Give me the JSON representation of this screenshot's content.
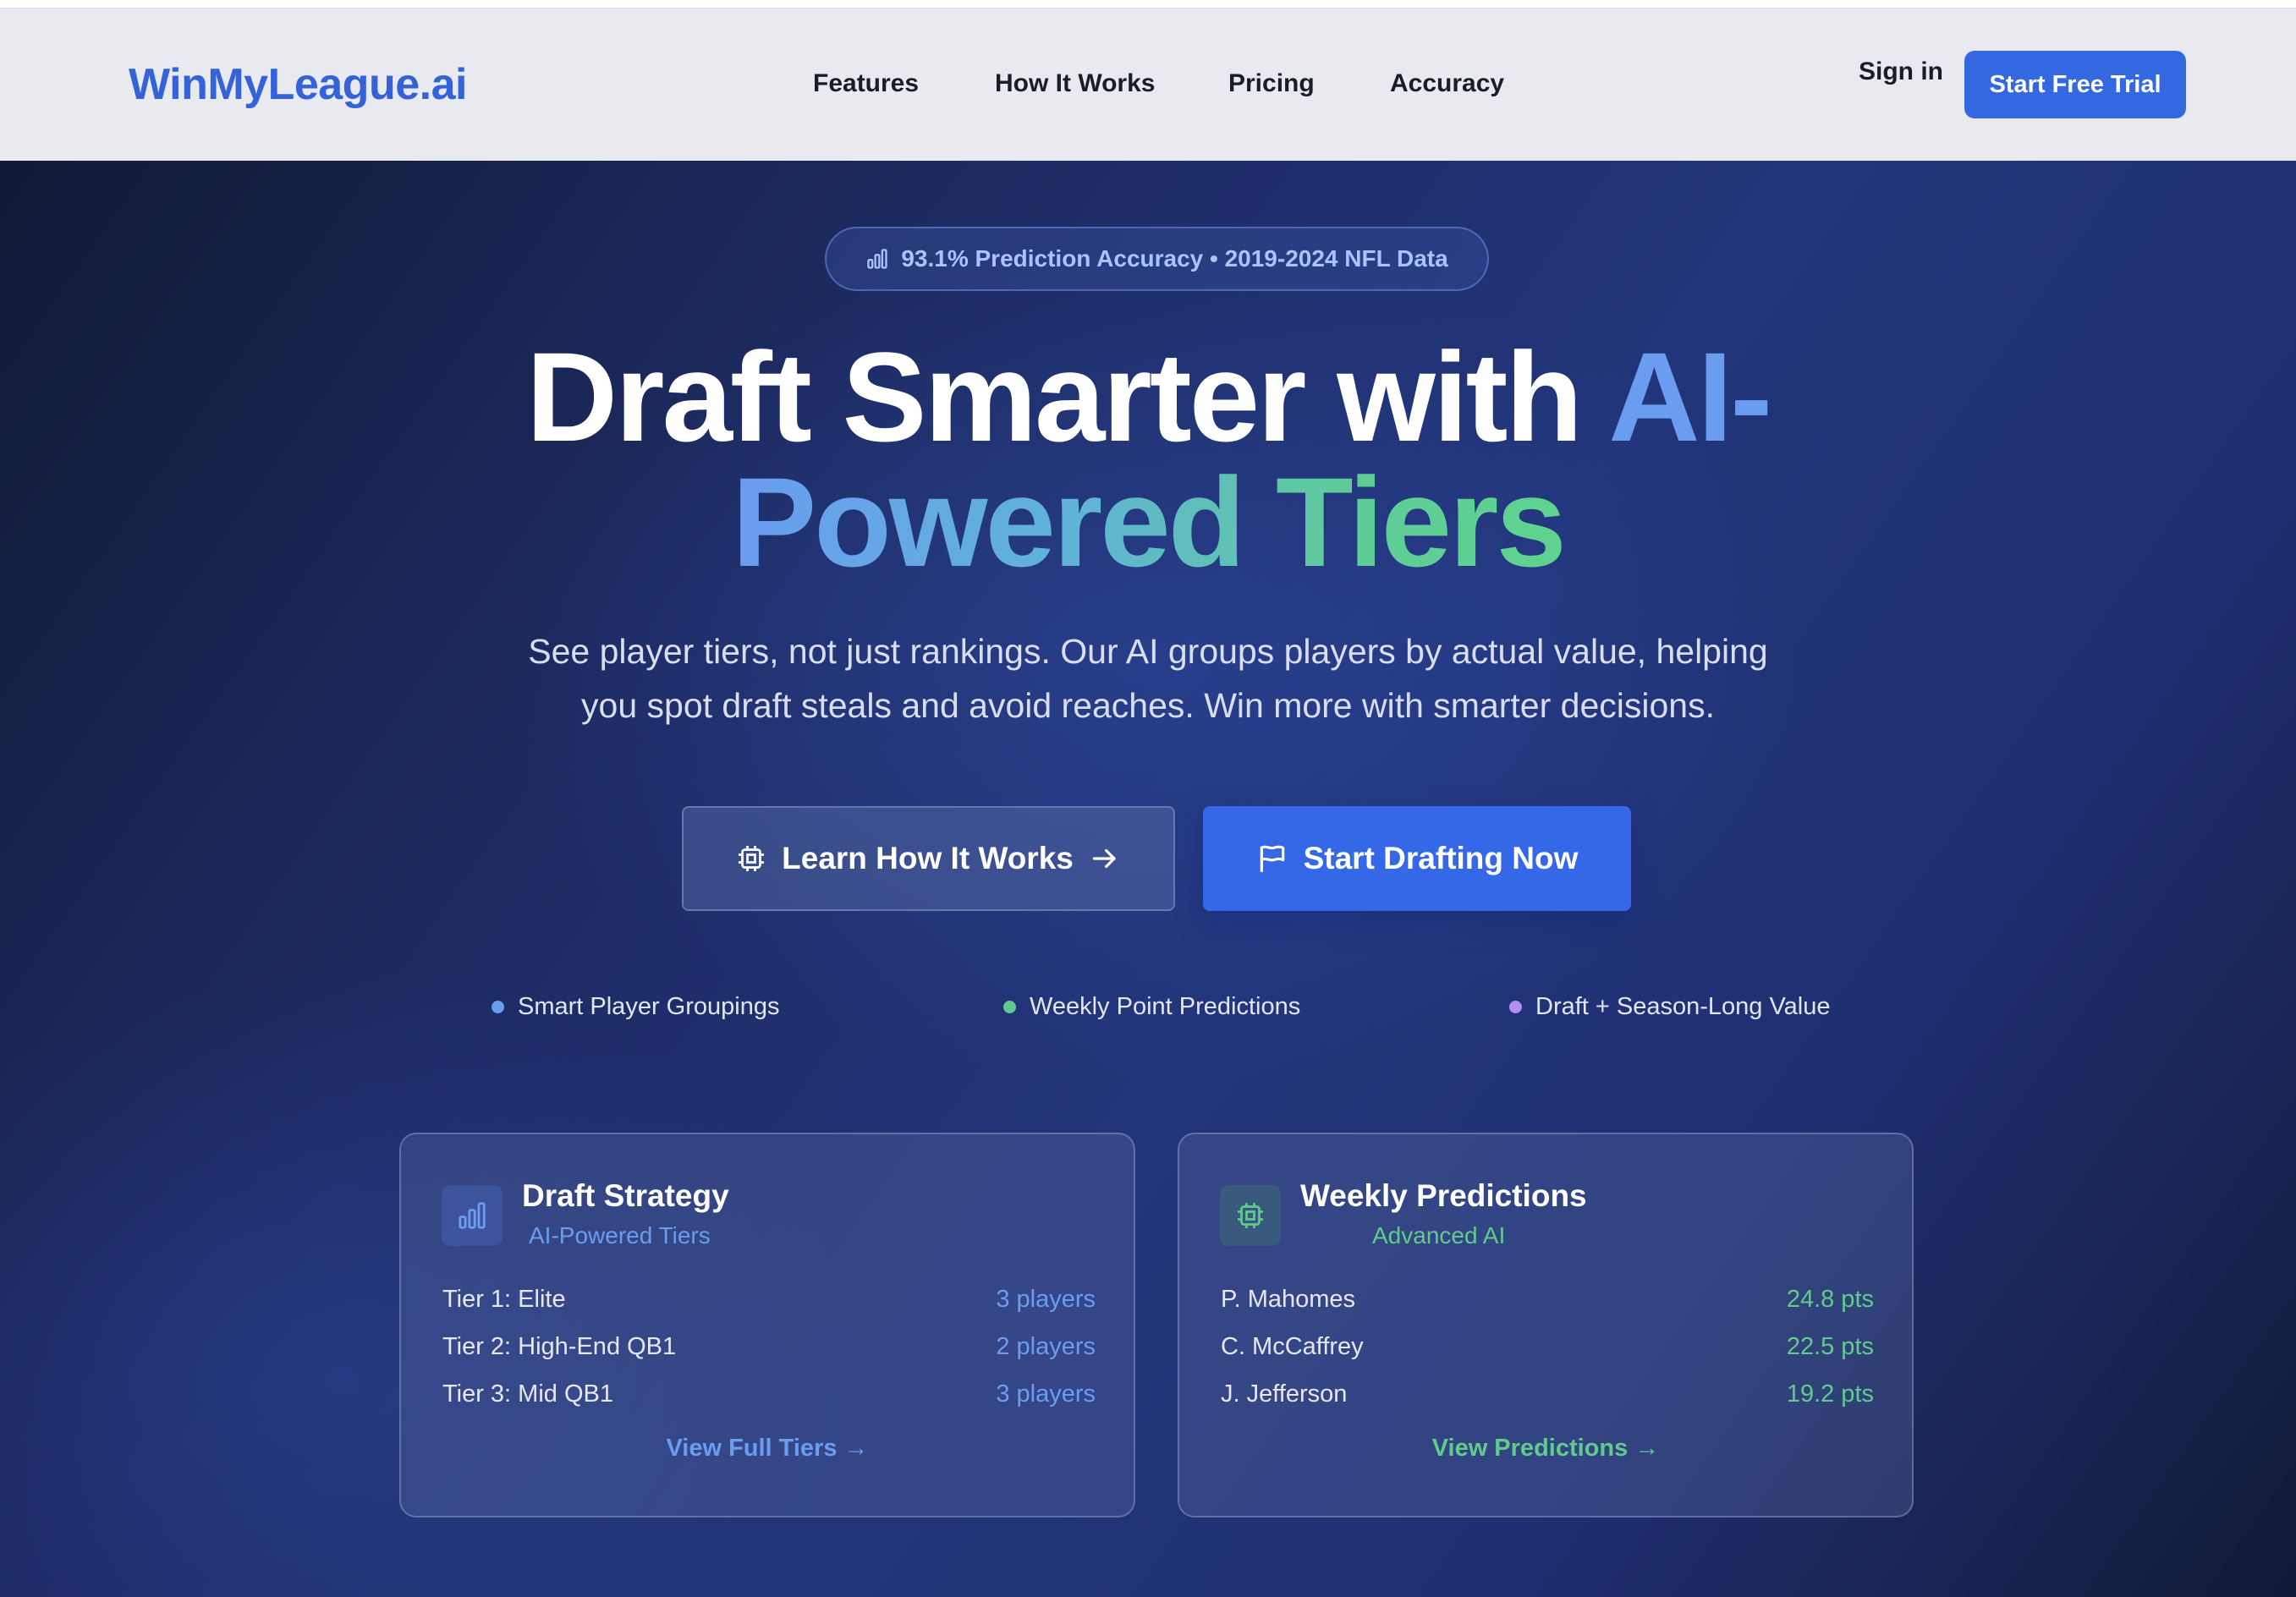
{
  "nav": {
    "logo": "WinMyLeague.ai",
    "links": [
      "Features",
      "How It Works",
      "Pricing",
      "Accuracy"
    ],
    "sign_in": "Sign in",
    "cta": "Start Free Trial"
  },
  "hero": {
    "badge": "93.1% Prediction Accuracy • 2019-2024 NFL Data",
    "headline_plain": "Draft Smarter with ",
    "headline_accent_1": "AI-",
    "headline_accent_2": "Powered Tiers",
    "subtitle_line1": "See player tiers, not just rankings. Our AI groups players by actual value, helping",
    "subtitle_line2": "you spot draft steals and avoid reaches. Win more with smarter decisions.",
    "learn_button": "Learn How It Works",
    "draft_button": "Start Drafting Now",
    "features": [
      {
        "label": "Smart Player Groupings",
        "color": "#6a9cf0"
      },
      {
        "label": "Weekly Point Predictions",
        "color": "#5fcc8e"
      },
      {
        "label": "Draft + Season-Long Value",
        "color": "#b38ef2"
      }
    ]
  },
  "cards": {
    "draft": {
      "title": "Draft Strategy",
      "subtitle": "AI-Powered Tiers",
      "rows": [
        {
          "label": "Tier 1: Elite",
          "value": "3 players"
        },
        {
          "label": "Tier 2: High-End QB1",
          "value": "2 players"
        },
        {
          "label": "Tier 3: Mid QB1",
          "value": "3 players"
        }
      ],
      "link": "View Full Tiers →",
      "accent": "#6a9cf0"
    },
    "weekly": {
      "title": "Weekly Predictions",
      "subtitle": "Advanced AI",
      "rows": [
        {
          "label": "P. Mahomes",
          "value": "24.8 pts"
        },
        {
          "label": "C. McCaffrey",
          "value": "22.5 pts"
        },
        {
          "label": "J. Jefferson",
          "value": "19.2 pts"
        }
      ],
      "link": "View Predictions →",
      "accent": "#5fcc8e"
    }
  },
  "icons": {
    "badge": "bar-chart-icon",
    "learn": "cpu-chip-icon",
    "draft": "flag-icon",
    "arrow": "arrow-right-icon"
  }
}
